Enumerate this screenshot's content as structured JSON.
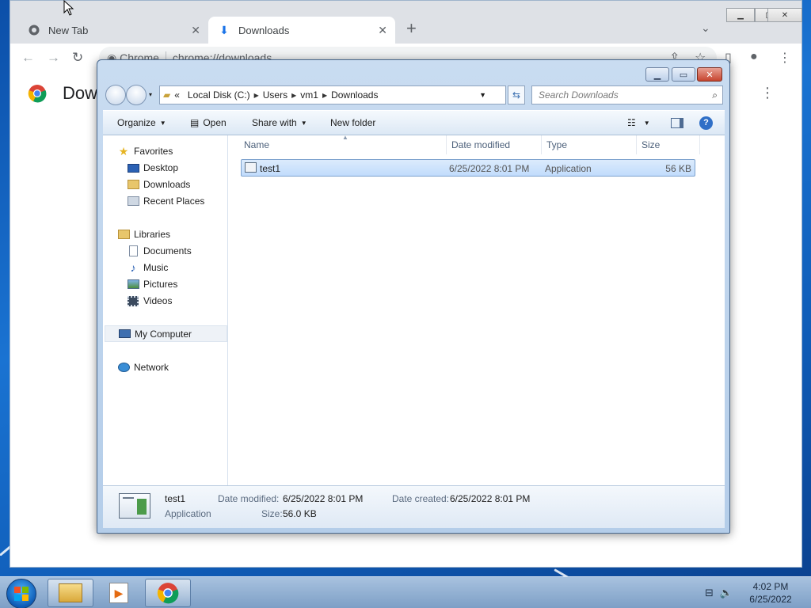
{
  "browser": {
    "tabs": [
      {
        "label": "New Tab",
        "icon": "chrome-icon",
        "active": false
      },
      {
        "label": "Downloads",
        "icon": "download-icon",
        "active": true
      }
    ],
    "omnibox": {
      "site_label": "Chrome",
      "url": "chrome://downloads"
    },
    "page_title": "Downloads"
  },
  "explorer": {
    "breadcrumb": {
      "overflow": "«",
      "items": [
        "Local Disk (C:)",
        "Users",
        "vm1",
        "Downloads"
      ]
    },
    "search_placeholder": "Search Downloads",
    "commands": {
      "organize": "Organize",
      "open": "Open",
      "share_with": "Share with",
      "new_folder": "New folder"
    },
    "nav": {
      "favorites": "Favorites",
      "desktop": "Desktop",
      "downloads": "Downloads",
      "recent_places": "Recent Places",
      "libraries": "Libraries",
      "documents": "Documents",
      "music": "Music",
      "pictures": "Pictures",
      "videos": "Videos",
      "my_computer": "My Computer",
      "network": "Network"
    },
    "columns": {
      "name": "Name",
      "date_modified": "Date modified",
      "type": "Type",
      "size": "Size"
    },
    "files": [
      {
        "name": "test1",
        "date_modified": "6/25/2022 8:01 PM",
        "type": "Application",
        "size": "56 KB"
      }
    ],
    "details": {
      "name": "test1",
      "type": "Application",
      "date_modified_label": "Date modified:",
      "date_modified": "6/25/2022 8:01 PM",
      "date_created_label": "Date created:",
      "date_created": "6/25/2022 8:01 PM",
      "size_label": "Size:",
      "size": "56.0 KB"
    }
  },
  "taskbar": {
    "apps": [
      "file-explorer-icon",
      "media-player-icon",
      "chrome-icon"
    ],
    "clock_time": "4:02 PM",
    "clock_date": "6/25/2022"
  },
  "colors": {
    "selection": "#c1dcfc",
    "accent": "#1a73d2",
    "close": "#c7452f"
  }
}
